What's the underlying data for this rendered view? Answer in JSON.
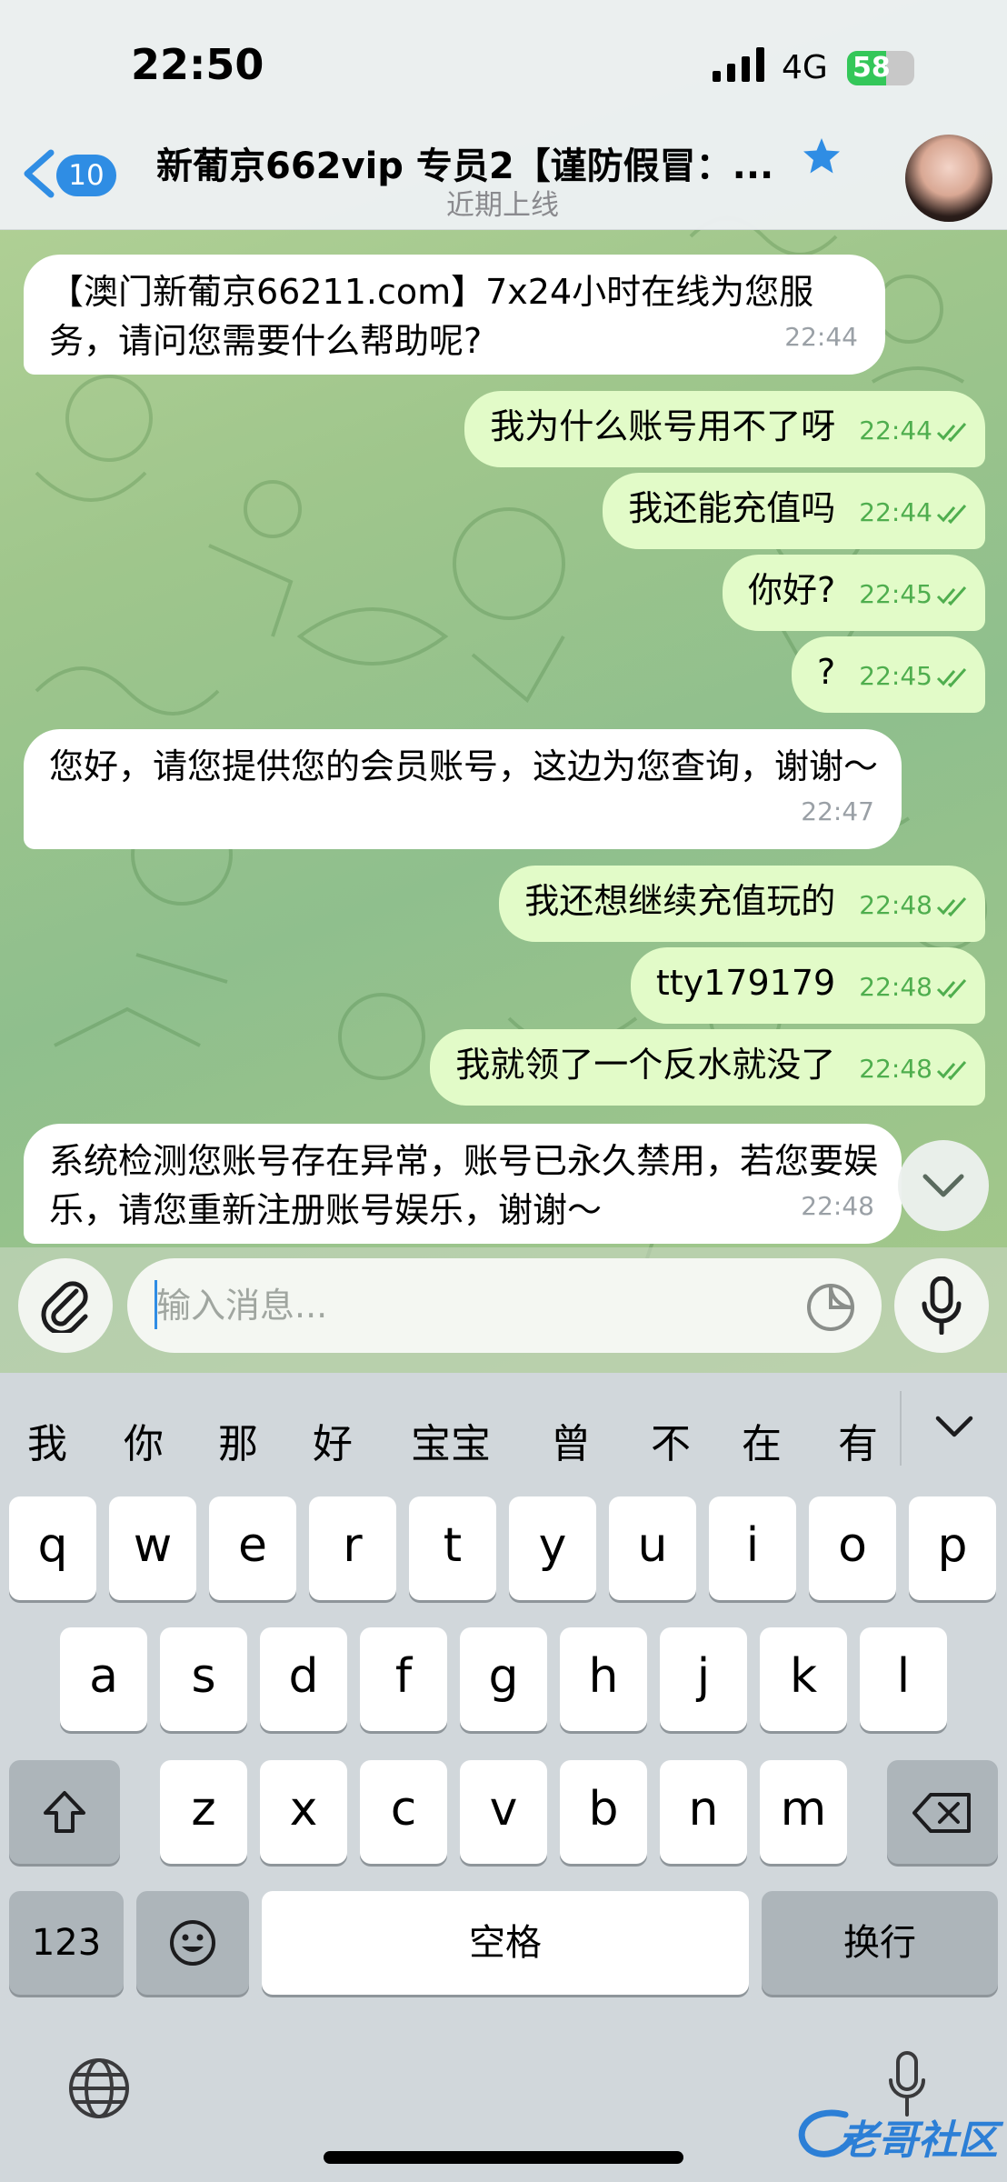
{
  "status_bar": {
    "time": "22:50",
    "network": "4G",
    "battery": "58",
    "battery_level": 0.58
  },
  "header": {
    "back_count": "10",
    "title": "新葡京662vip 专员2【谨防假冒：...",
    "subtitle": "近期上线"
  },
  "messages": [
    {
      "dir": "in",
      "text": "【澳门新葡京66211.com】7x24小时在线为您服务，请问您需要什么帮助呢?",
      "time": "22:44"
    },
    {
      "dir": "out",
      "text": "我为什么账号用不了呀",
      "time": "22:44"
    },
    {
      "dir": "out",
      "text": "我还能充值吗",
      "time": "22:44"
    },
    {
      "dir": "out",
      "text": "你好?",
      "time": "22:45"
    },
    {
      "dir": "out",
      "text": "?",
      "time": "22:45"
    },
    {
      "dir": "in",
      "text": "您好，请您提供您的会员账号，这边为您查询，谢谢～",
      "time": "22:47"
    },
    {
      "dir": "out",
      "text": "我还想继续充值玩的",
      "time": "22:48"
    },
    {
      "dir": "out",
      "text": "tty179179",
      "time": "22:48"
    },
    {
      "dir": "out",
      "text": "我就领了一个反水就没了",
      "time": "22:48"
    },
    {
      "dir": "in",
      "text": "系统检测您账号存在异常，账号已永久禁用，若您要娱乐，请您重新注册账号娱乐，谢谢～",
      "time": "22:48"
    }
  ],
  "input": {
    "placeholder": "输入消息..."
  },
  "keyboard": {
    "candidates": [
      "我",
      "你",
      "那",
      "好",
      "宝宝",
      "曾",
      "不",
      "在",
      "有"
    ],
    "row1": [
      "q",
      "w",
      "e",
      "r",
      "t",
      "y",
      "u",
      "i",
      "o",
      "p"
    ],
    "row2": [
      "a",
      "s",
      "d",
      "f",
      "g",
      "h",
      "j",
      "k",
      "l"
    ],
    "row3": [
      "z",
      "x",
      "c",
      "v",
      "b",
      "n",
      "m"
    ],
    "numbers_label": "123",
    "space_label": "空格",
    "return_label": "换行"
  },
  "colors": {
    "accent": "#2f8de4",
    "outgoing_bubble": "#e2fbc8",
    "incoming_bubble": "#ffffff",
    "read_ticks": "#4fae4e"
  },
  "watermark": {
    "text": "老哥社区"
  }
}
